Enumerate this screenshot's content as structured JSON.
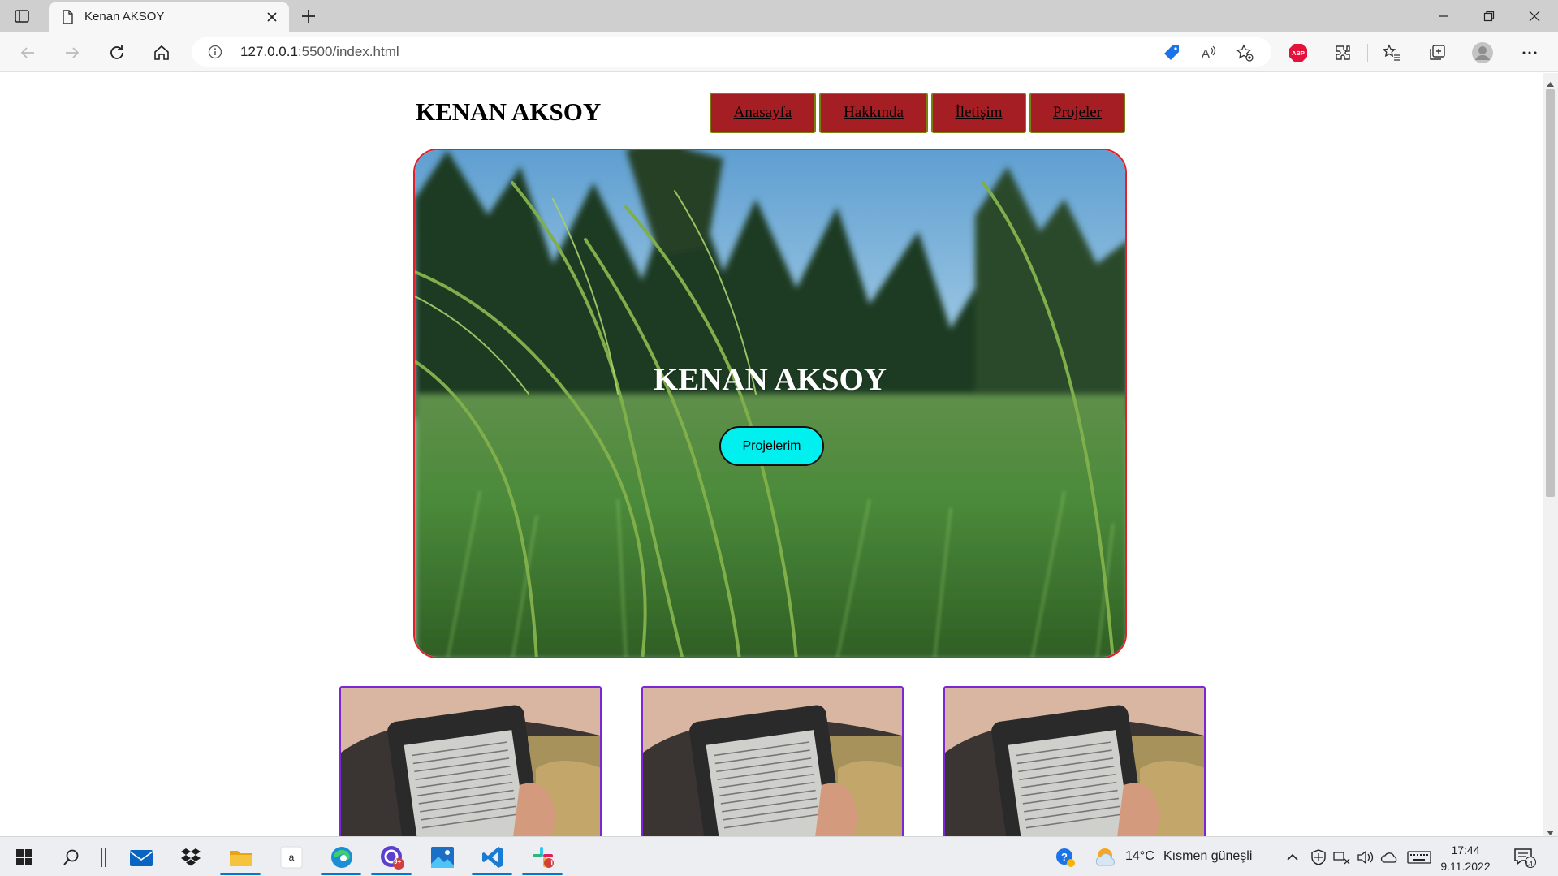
{
  "browser": {
    "tab_title": "Kenan AKSOY",
    "url_host": "127.0.0.1",
    "url_rest": ":5500/index.html"
  },
  "site": {
    "title": "KENAN AKSOY",
    "nav": [
      "Anasayfa",
      "Hakkında",
      "İletişim",
      "Projeler"
    ],
    "hero_title": "KENAN AKSOY",
    "hero_button": "Projelerim"
  },
  "taskbar": {
    "weather_temp": "14°C",
    "weather_desc": "Kısmen güneşli",
    "time": "17:44",
    "date": "9.11.2022",
    "notification_count": "14",
    "photos_badge": "9+",
    "slack_badge": "1"
  },
  "colors": {
    "nav_bg": "#a41e23",
    "hero_border": "#e0202a",
    "hero_button": "#00f0f0",
    "card_border": "#7b27d6"
  }
}
